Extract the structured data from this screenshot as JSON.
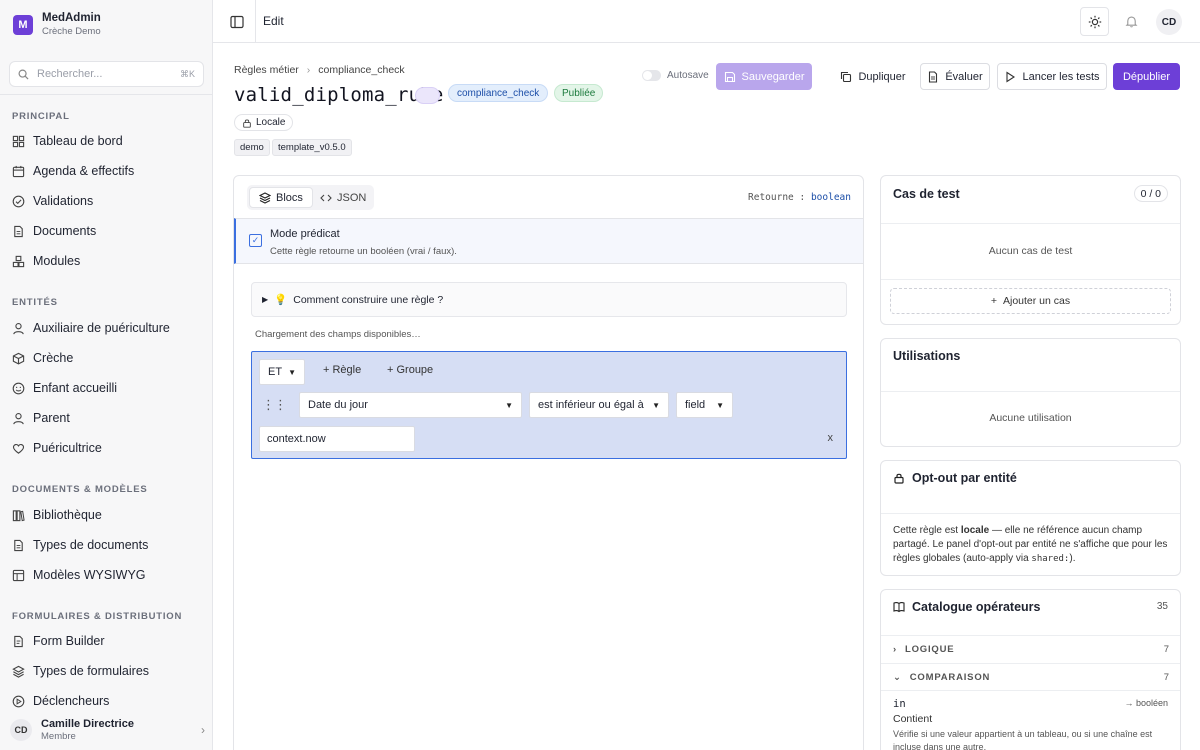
{
  "app": {
    "name": "MedAdmin",
    "org": "Crèche Demo",
    "logo_letter": "M"
  },
  "search": {
    "placeholder": "Rechercher...",
    "shortcut": "⌘K"
  },
  "sidebar": {
    "sections": [
      {
        "title": "PRINCIPAL",
        "items": [
          {
            "label": "Tableau de bord",
            "icon": "dashboard-icon"
          },
          {
            "label": "Agenda & effectifs",
            "icon": "calendar-icon"
          },
          {
            "label": "Validations",
            "icon": "check-circle-icon"
          },
          {
            "label": "Documents",
            "icon": "document-icon"
          },
          {
            "label": "Modules",
            "icon": "modules-icon"
          }
        ]
      },
      {
        "title": "ENTITÉS",
        "items": [
          {
            "label": "Auxiliaire de puériculture",
            "icon": "user-icon"
          },
          {
            "label": "Crèche",
            "icon": "cube-icon"
          },
          {
            "label": "Enfant accueilli",
            "icon": "smiley-icon"
          },
          {
            "label": "Parent",
            "icon": "user-icon"
          },
          {
            "label": "Puéricultrice",
            "icon": "heart-icon"
          }
        ]
      },
      {
        "title": "DOCUMENTS & MODÈLES",
        "items": [
          {
            "label": "Bibliothèque",
            "icon": "library-icon"
          },
          {
            "label": "Types de documents",
            "icon": "document-icon"
          },
          {
            "label": "Modèles WYSIWYG",
            "icon": "template-icon"
          }
        ]
      },
      {
        "title": "FORMULAIRES & DISTRIBUTION",
        "items": [
          {
            "label": "Form Builder",
            "icon": "form-icon"
          },
          {
            "label": "Types de formulaires",
            "icon": "layers-icon"
          },
          {
            "label": "Déclencheurs",
            "icon": "trigger-icon"
          }
        ]
      }
    ]
  },
  "user": {
    "initials": "CD",
    "name": "Camille Directrice",
    "role": "Membre"
  },
  "topbar": {
    "title": "Edit",
    "avatar": "CD"
  },
  "header": {
    "breadcrumb": [
      "Règles métier",
      "compliance_check"
    ],
    "rule_name": "valid_diploma_rule",
    "category_pill": "compliance_check",
    "status_pill": "Publiée",
    "scope": "Locale",
    "tags": [
      "demo",
      "template_v0.5.0"
    ]
  },
  "actions": {
    "autosave": "Autosave",
    "save": "Sauvegarder",
    "duplicate": "Dupliquer",
    "evaluate": "Évaluer",
    "run_tests": "Lancer les tests",
    "unpublish": "Dépublier"
  },
  "editor": {
    "tabs": [
      "Blocs",
      "JSON"
    ],
    "returns_label": "Retourne :",
    "returns_type": "boolean",
    "mode_title": "Mode prédicat",
    "mode_sub": "Cette règle retourne un booléen (vrai / faux).",
    "howto": "Comment construire une règle ?",
    "loading": "Chargement des champs disponibles…",
    "group_operator": "ET",
    "add_rule": "+ Règle",
    "add_group": "+ Groupe",
    "field": "Date du jour",
    "operator": "est inférieur ou égal à",
    "value_source": "field",
    "value": "context.now",
    "remove": "x"
  },
  "tests": {
    "title": "Cas de test",
    "counter": "0 / 0",
    "empty": "Aucun cas de test",
    "add": "Ajouter un cas"
  },
  "usages": {
    "title": "Utilisations",
    "empty": "Aucune utilisation"
  },
  "optout": {
    "title": "Opt-out par entité",
    "text_1": "Cette règle est ",
    "text_bold": "locale",
    "text_2": " — elle ne référence aucun champ partagé. Le panel d'opt-out par entité ne s'affiche que pour les règles globales (auto-apply via ",
    "text_code": "shared:",
    "text_3": ")."
  },
  "catalog": {
    "title": "Catalogue opérateurs",
    "count": "35",
    "groups": [
      {
        "name": "LOGIQUE",
        "count": "7"
      },
      {
        "name": "COMPARAISON",
        "count": "7"
      }
    ],
    "operator": {
      "name": "in",
      "returns": "→ booléen",
      "label": "Contient",
      "description": "Vérifie si une valeur appartient à un tableau, ou si une chaîne est incluse dans une autre."
    }
  }
}
